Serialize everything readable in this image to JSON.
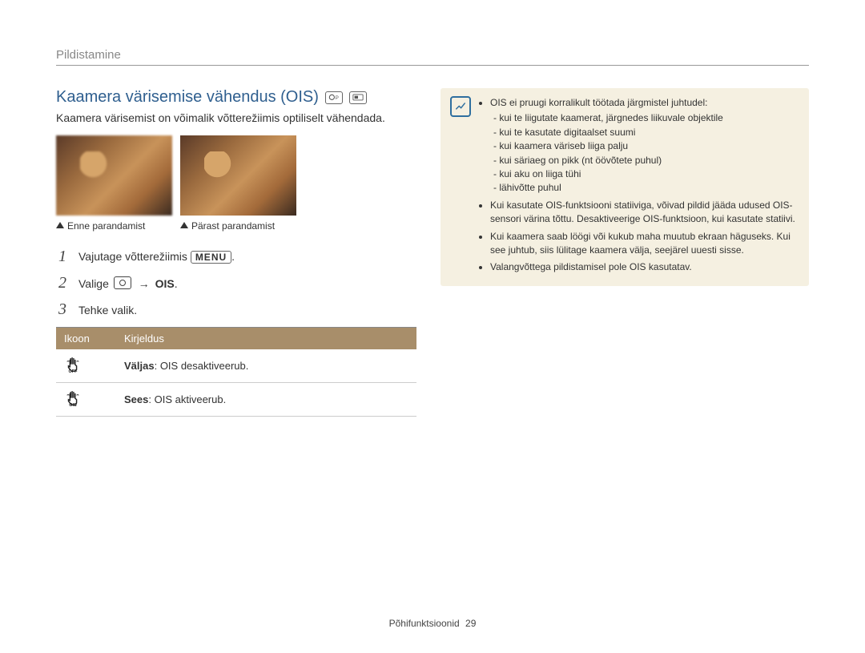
{
  "section": "Pildistamine",
  "title": "Kaamera värisemise vähendus (OIS)",
  "mode_icons": [
    "program-mode-icon",
    "scene-mode-icon"
  ],
  "intro": "Kaamera värisemist on võimalik võtterežiimis optiliselt vähendada.",
  "captions": {
    "before": "Enne parandamist",
    "after": "Pärast parandamist"
  },
  "steps": {
    "s1_prefix": "Vajutage võtterežiimis ",
    "s1_menu": "MENU",
    "s2_prefix": "Valige ",
    "s2_target": "OIS",
    "s3": "Tehke valik."
  },
  "table": {
    "col_icon": "Ikoon",
    "col_desc": "Kirjeldus",
    "rows": [
      {
        "icon": "ois-off-icon",
        "label": "Väljas",
        "desc": ": OIS desaktiveerub."
      },
      {
        "icon": "ois-on-icon",
        "label": "Sees",
        "desc": ": OIS aktiveerub."
      }
    ]
  },
  "note": {
    "lead": "OIS ei pruugi korralikult töötada järgmistel juhtudel:",
    "sub": [
      "kui te liigutate kaamerat, järgnedes liikuvale objektile",
      "kui te kasutate digitaalset suumi",
      "kui kaamera väriseb liiga palju",
      "kui säriaeg on pikk (nt öövõtete puhul)",
      "kui aku on liiga tühi",
      "lähivõtte puhul"
    ],
    "tripod": "Kui kasutate OIS-funktsiooni statiiviga, võivad pildid jääda udused OIS-sensori värina tõttu. Desaktiveerige OIS-funktsioon, kui kasutate statiivi.",
    "knock": "Kui kaamera saab löögi või kukub maha muutub ekraan häguseks. Kui see juhtub, siis lülitage kaamera välja, seejärel uuesti sisse.",
    "burst": "Valangvõttega pildistamisel pole OIS kasutatav."
  },
  "footer": {
    "label": "Põhifunktsioonid",
    "page": "29"
  }
}
